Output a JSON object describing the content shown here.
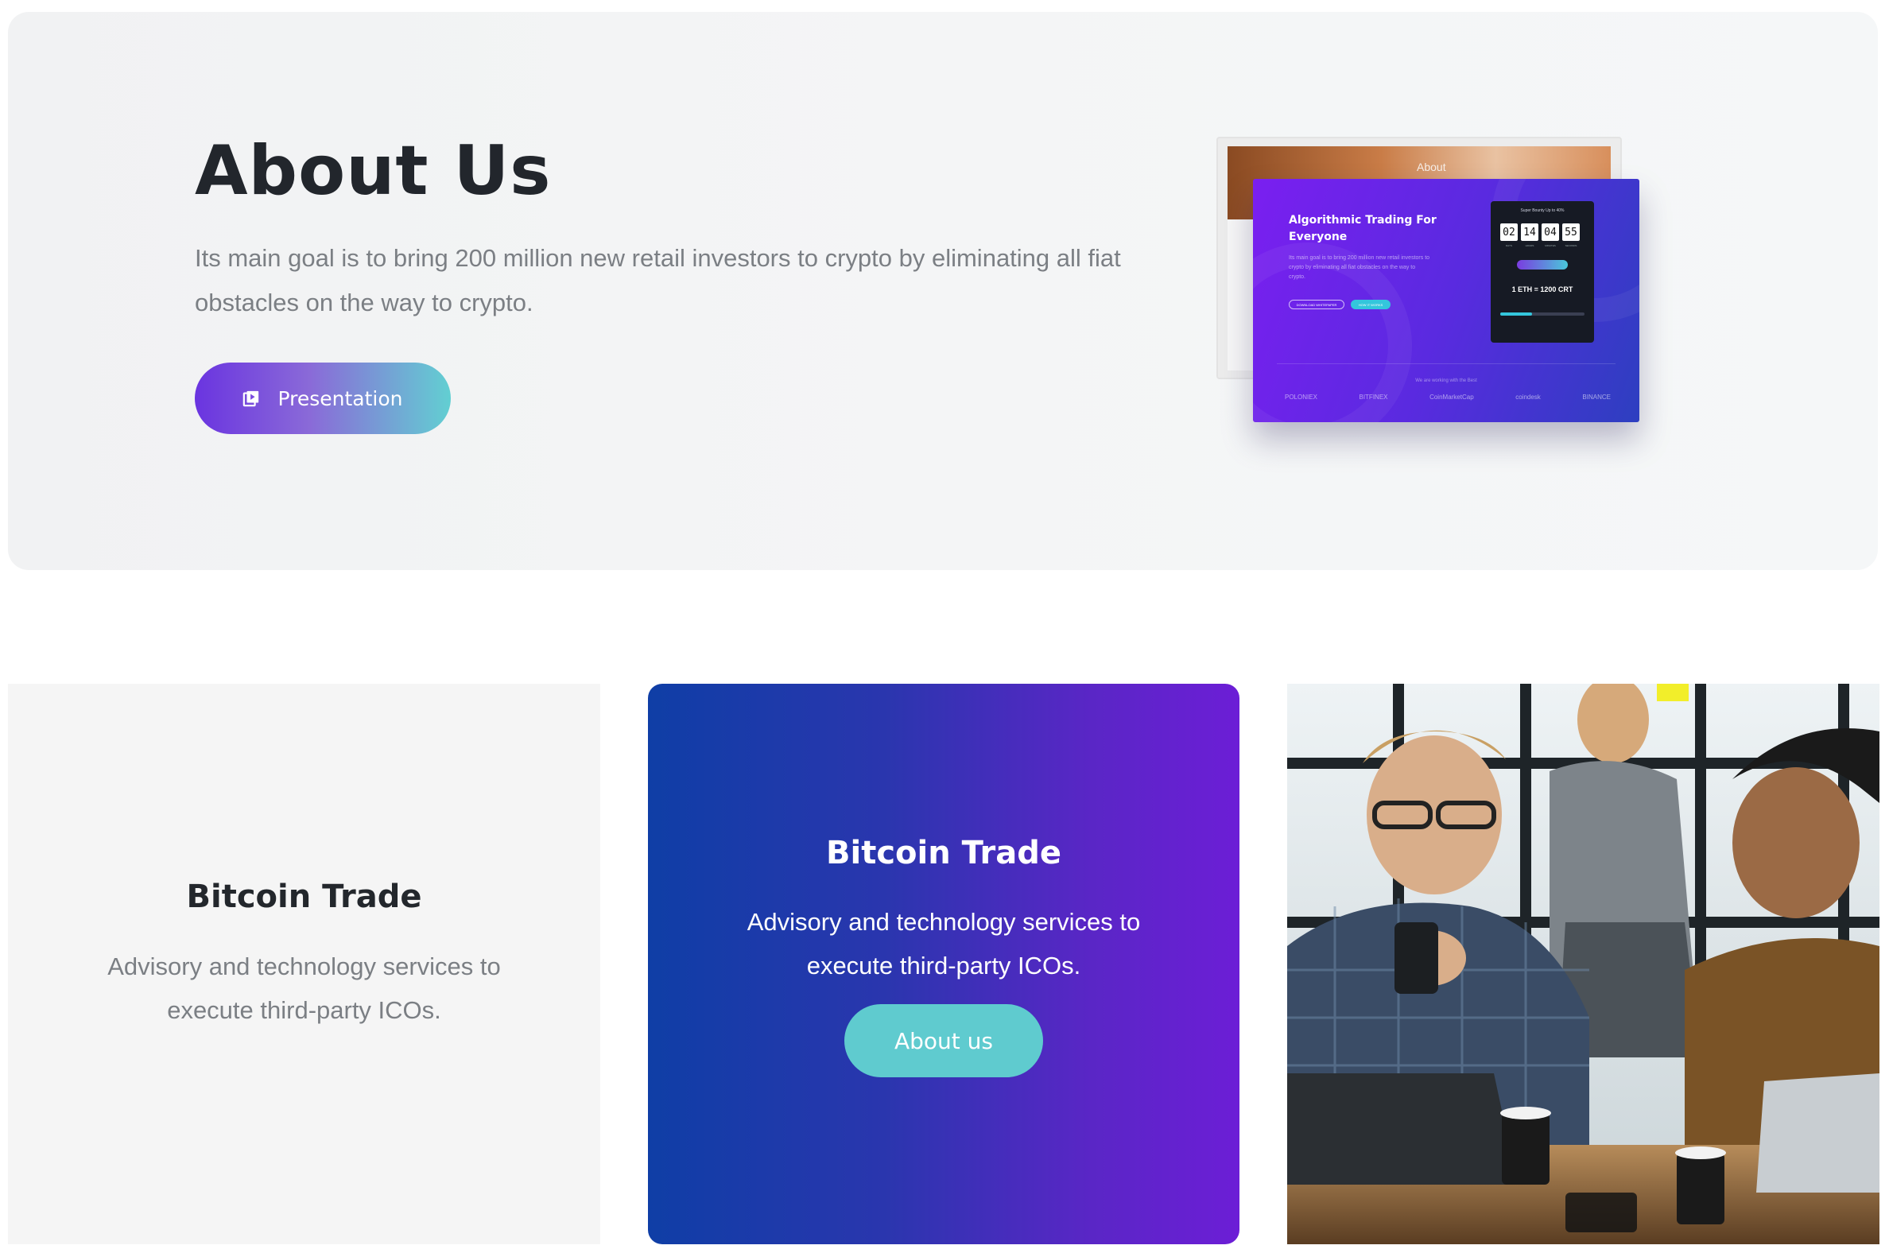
{
  "about": {
    "title": "About Us",
    "description": "Its main goal is to bring 200 million new retail investors to crypto by eliminating all fiat obstacles on the way to crypto.",
    "button_label": "Presentation",
    "button_icon": "play-video-icon",
    "gradient_start": "#6a34e0",
    "gradient_end": "#62cfd2"
  },
  "mockup": {
    "back_label": "About",
    "title": "Algorithmic Trading For Everyone",
    "subtitle": "Its main goal is to bring 200 million new retail investors to crypto by eliminating all fiat obstacles on the way to crypto.",
    "btn_primary": "DOWNLOAD WHITEPAPER",
    "btn_secondary": "HOW IT WORKS",
    "panel_heading": "Super Bounty Up to 40%",
    "countdown": [
      "02",
      "14",
      "04",
      "55"
    ],
    "countdown_units": [
      "DAYS",
      "HOURS",
      "MINUTES",
      "SECONDS"
    ],
    "rate": "1 ETH = 1200 CRT",
    "partners_label": "We are working with the Best",
    "partners": [
      "POLONIEX",
      "BITFINEX",
      "CoinMarketCap",
      "coindesk",
      "BINANCE"
    ]
  },
  "features": {
    "left": {
      "title": "Bitcoin Trade",
      "text": "Advisory and technology services to execute third-party ICOs."
    },
    "middle": {
      "title": "Bitcoin Trade",
      "text": "Advisory and technology services to execute third-party ICOs.",
      "button_label": "About us",
      "gradient_start": "#0f3ea6",
      "gradient_end": "#6c1ed6",
      "button_color": "#5fcbcf"
    },
    "photo": {
      "alt": "team-working-photo"
    }
  }
}
